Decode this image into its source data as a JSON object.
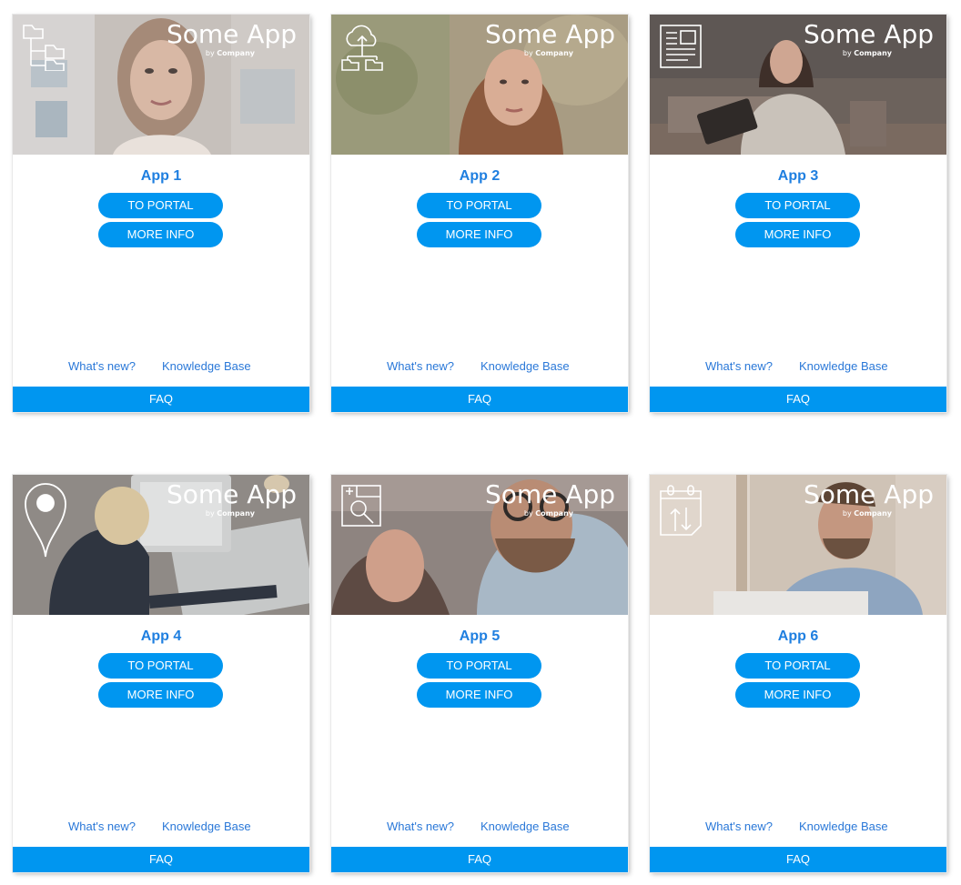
{
  "brand": {
    "name": "Some App",
    "by": "by",
    "company": "Company"
  },
  "cards": [
    {
      "title": "App 1",
      "portal_label": "TO PORTAL",
      "info_label": "MORE INFO",
      "whats_new": "What's new?",
      "knowledge_base": "Knowledge Base",
      "faq": "FAQ",
      "icon": "folder-tree-icon"
    },
    {
      "title": "App 2",
      "portal_label": "TO PORTAL",
      "info_label": "MORE INFO",
      "whats_new": "What's new?",
      "knowledge_base": "Knowledge Base",
      "faq": "FAQ",
      "icon": "cloud-upload-folders-icon"
    },
    {
      "title": "App 3",
      "portal_label": "TO PORTAL",
      "info_label": "MORE INFO",
      "whats_new": "What's new?",
      "knowledge_base": "Knowledge Base",
      "faq": "FAQ",
      "icon": "newspaper-icon"
    },
    {
      "title": "App 4",
      "portal_label": "TO PORTAL",
      "info_label": "MORE INFO",
      "whats_new": "What's new?",
      "knowledge_base": "Knowledge Base",
      "faq": "FAQ",
      "icon": "map-pin-icon"
    },
    {
      "title": "App 5",
      "portal_label": "TO PORTAL",
      "info_label": "MORE INFO",
      "whats_new": "What's new?",
      "knowledge_base": "Knowledge Base",
      "faq": "FAQ",
      "icon": "window-search-icon"
    },
    {
      "title": "App 6",
      "portal_label": "TO PORTAL",
      "info_label": "MORE INFO",
      "whats_new": "What's new?",
      "knowledge_base": "Knowledge Base",
      "faq": "FAQ",
      "icon": "calendar-sync-icon"
    }
  ],
  "colors": {
    "accent": "#0096f0",
    "title": "#1f7fe0",
    "link": "#2a78d8"
  }
}
